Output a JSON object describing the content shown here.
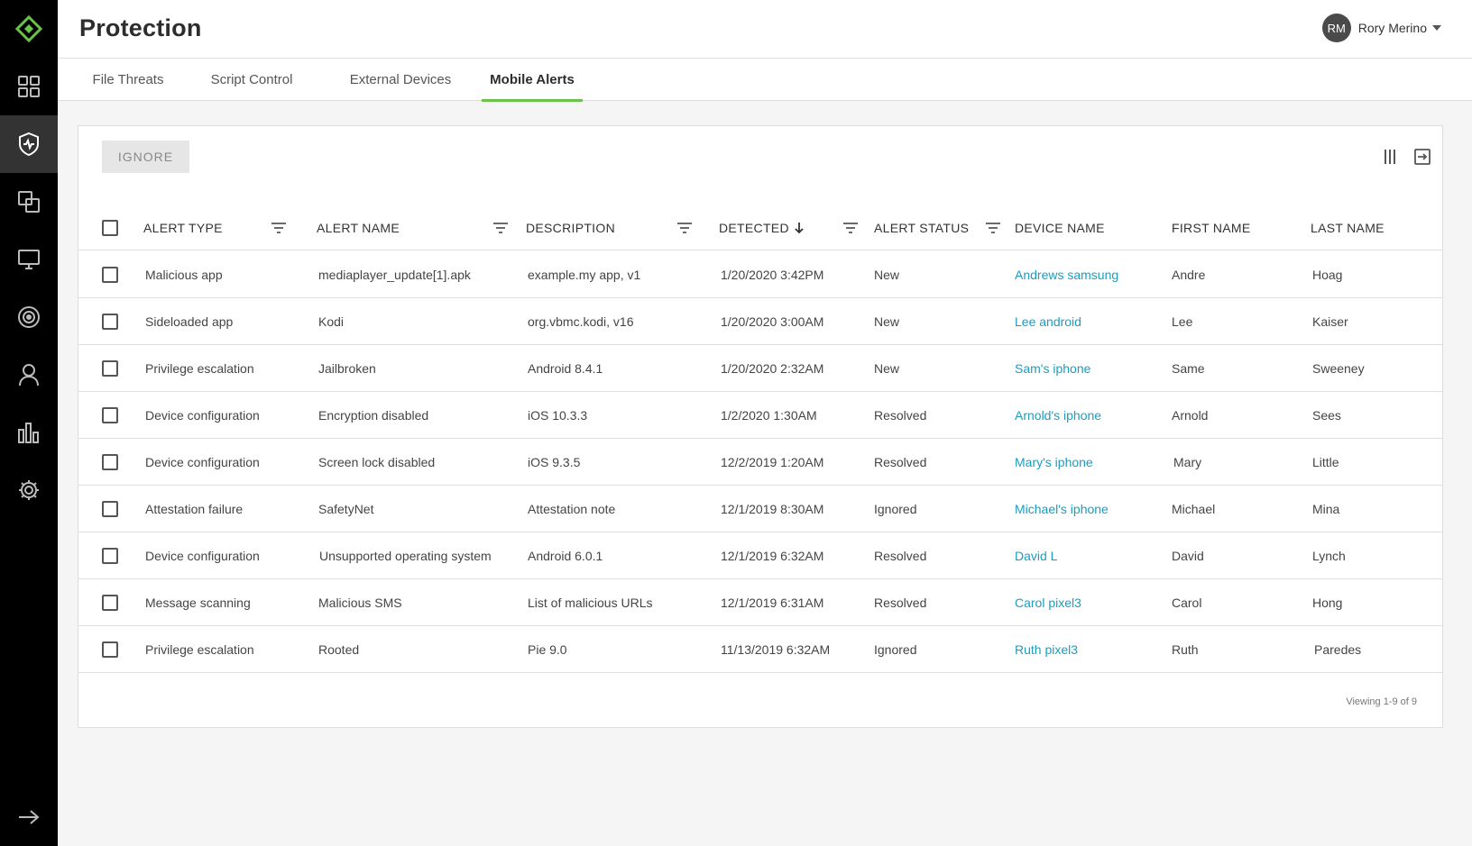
{
  "app": {
    "page_title": "Protection",
    "user": {
      "initials": "RM",
      "name": "Rory Merino"
    }
  },
  "sidebar": {
    "items": [
      {
        "icon": "logo-icon"
      },
      {
        "icon": "dashboard-icon"
      },
      {
        "icon": "protection-shield-icon"
      },
      {
        "icon": "zones-icon"
      },
      {
        "icon": "devices-icon"
      },
      {
        "icon": "threat-target-icon"
      },
      {
        "icon": "user-icon"
      },
      {
        "icon": "reports-icon"
      },
      {
        "icon": "settings-gear-icon"
      },
      {
        "icon": "expand-arrow-icon"
      }
    ]
  },
  "tabs": [
    {
      "label": "File Threats"
    },
    {
      "label": "Script Control"
    },
    {
      "label": "External Devices"
    },
    {
      "label": "Mobile Alerts",
      "active": true
    }
  ],
  "toolbar": {
    "ignore_label": "IGNORE"
  },
  "table": {
    "columns": [
      {
        "label": "ALERT TYPE",
        "filter": true
      },
      {
        "label": "ALERT NAME",
        "filter": true
      },
      {
        "label": "DESCRIPTION",
        "filter": true
      },
      {
        "label": "DETECTED",
        "sort": "desc",
        "filter": true
      },
      {
        "label": "ALERT STATUS",
        "filter": true
      },
      {
        "label": "DEVICE NAME"
      },
      {
        "label": "FIRST NAME"
      },
      {
        "label": "LAST NAME"
      }
    ],
    "rows": [
      {
        "alert_type": "Malicious app",
        "alert_name": "mediaplayer_update[1].apk",
        "description": "example.my app, v1",
        "detected": "1/20/2020 3:42PM",
        "status": "New",
        "device": "Andrews samsung",
        "first": "Andre",
        "last": "Hoag"
      },
      {
        "alert_type": "Sideloaded app",
        "alert_name": "Kodi",
        "description": "org.vbmc.kodi, v16",
        "detected": "1/20/2020 3:00AM",
        "status": "New",
        "device": "Lee android",
        "first": "Lee",
        "last": "Kaiser"
      },
      {
        "alert_type": "Privilege escalation",
        "alert_name": "Jailbroken",
        "description": "Android 8.4.1",
        "detected": "1/20/2020 2:32AM",
        "status": "New",
        "device": "Sam's iphone",
        "first": "Same",
        "last": "Sweeney"
      },
      {
        "alert_type": "Device configuration",
        "alert_name": "Encryption disabled",
        "description": "iOS 10.3.3",
        "detected": "1/2/2020 1:30AM",
        "status": "Resolved",
        "device": "Arnold's iphone",
        "first": "Arnold",
        "last": "Sees"
      },
      {
        "alert_type": "Device configuration",
        "alert_name": "Screen lock disabled",
        "description": "iOS 9.3.5",
        "detected": "12/2/2019 1:20AM",
        "status": "Resolved",
        "device": "Mary's iphone",
        "first": "Mary",
        "last": "Little"
      },
      {
        "alert_type": "Attestation failure",
        "alert_name": "SafetyNet",
        "description": "Attestation note",
        "detected": "12/1/2019 8:30AM",
        "status": "Ignored",
        "device": "Michael's iphone",
        "first": "Michael",
        "last": "Mina"
      },
      {
        "alert_type": "Device configuration",
        "alert_name": "Unsupported operating system",
        "description": "Android 6.0.1",
        "detected": "12/1/2019 6:32AM",
        "status": "Resolved",
        "device": "David L",
        "first": "David",
        "last": "Lynch"
      },
      {
        "alert_type": "Message scanning",
        "alert_name": "Malicious SMS",
        "description": "List of malicious URLs",
        "detected": "12/1/2019 6:31AM",
        "status": "Resolved",
        "device": "Carol pixel3",
        "first": "Carol",
        "last": "Hong"
      },
      {
        "alert_type": "Privilege escalation",
        "alert_name": "Rooted",
        "description": "Pie 9.0",
        "detected": "11/13/2019 6:32AM",
        "status": "Ignored",
        "device": "Ruth pixel3",
        "first": "Ruth",
        "last": "Paredes"
      }
    ],
    "footer": "Viewing 1-9 of 9"
  },
  "colors": {
    "accent_green": "#6cc24a",
    "link_blue": "#1a9dbf",
    "sidebar_bg": "#000000"
  }
}
